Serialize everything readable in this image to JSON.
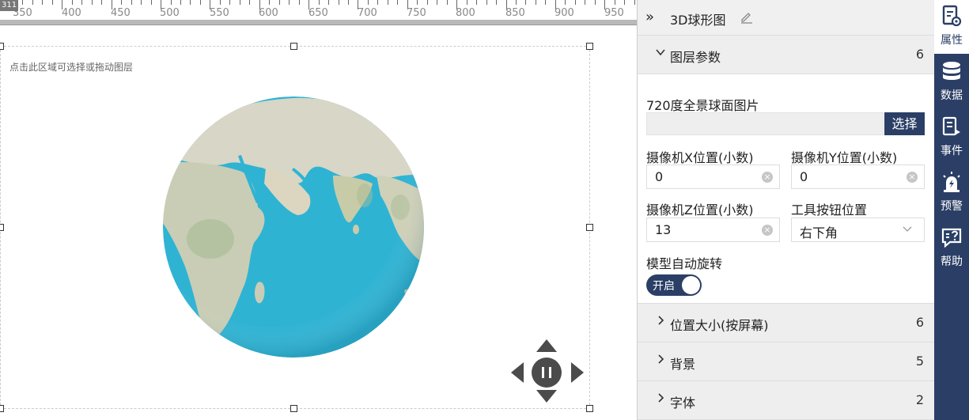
{
  "ruler": {
    "origin": "311",
    "labels": [
      "350",
      "400",
      "450",
      "500",
      "550",
      "600",
      "650",
      "700",
      "750",
      "800",
      "850",
      "900",
      "950"
    ]
  },
  "canvas": {
    "hint": "点击此区域可选择或拖动图层",
    "controls": [
      "up-arrow-icon",
      "down-arrow-icon",
      "left-arrow-icon",
      "right-arrow-icon",
      "pause-icon"
    ]
  },
  "panel": {
    "title": "3D球形图",
    "layer_section": {
      "label": "图层参数",
      "count": "6"
    },
    "fields": {
      "image_label": "720度全景球面图片",
      "image_value": "",
      "image_button": "选择",
      "cam_x_label": "摄像机X位置(小数)",
      "cam_x_value": "0",
      "cam_y_label": "摄像机Y位置(小数)",
      "cam_y_value": "0",
      "cam_z_label": "摄像机Z位置(小数)",
      "cam_z_value": "13",
      "tool_pos_label": "工具按钮位置",
      "tool_pos_value": "右下角",
      "auto_rotate_label": "模型自动旋转",
      "auto_rotate_toggle": "开启"
    },
    "sections": [
      {
        "label": "位置大小(按屏幕)",
        "count": "6"
      },
      {
        "label": "背景",
        "count": "5"
      },
      {
        "label": "字体",
        "count": "2"
      }
    ]
  },
  "side_nav": [
    {
      "label": "属性",
      "icon": "properties-icon",
      "active": true
    },
    {
      "label": "数据",
      "icon": "database-icon",
      "active": false
    },
    {
      "label": "事件",
      "icon": "event-icon",
      "active": false
    },
    {
      "label": "预警",
      "icon": "alarm-icon",
      "active": false
    },
    {
      "label": "帮助",
      "icon": "help-icon",
      "active": false
    }
  ],
  "colors": {
    "accent": "#2b3f66",
    "ocean": "#2fb3d3",
    "land": "#d4d2c2"
  }
}
